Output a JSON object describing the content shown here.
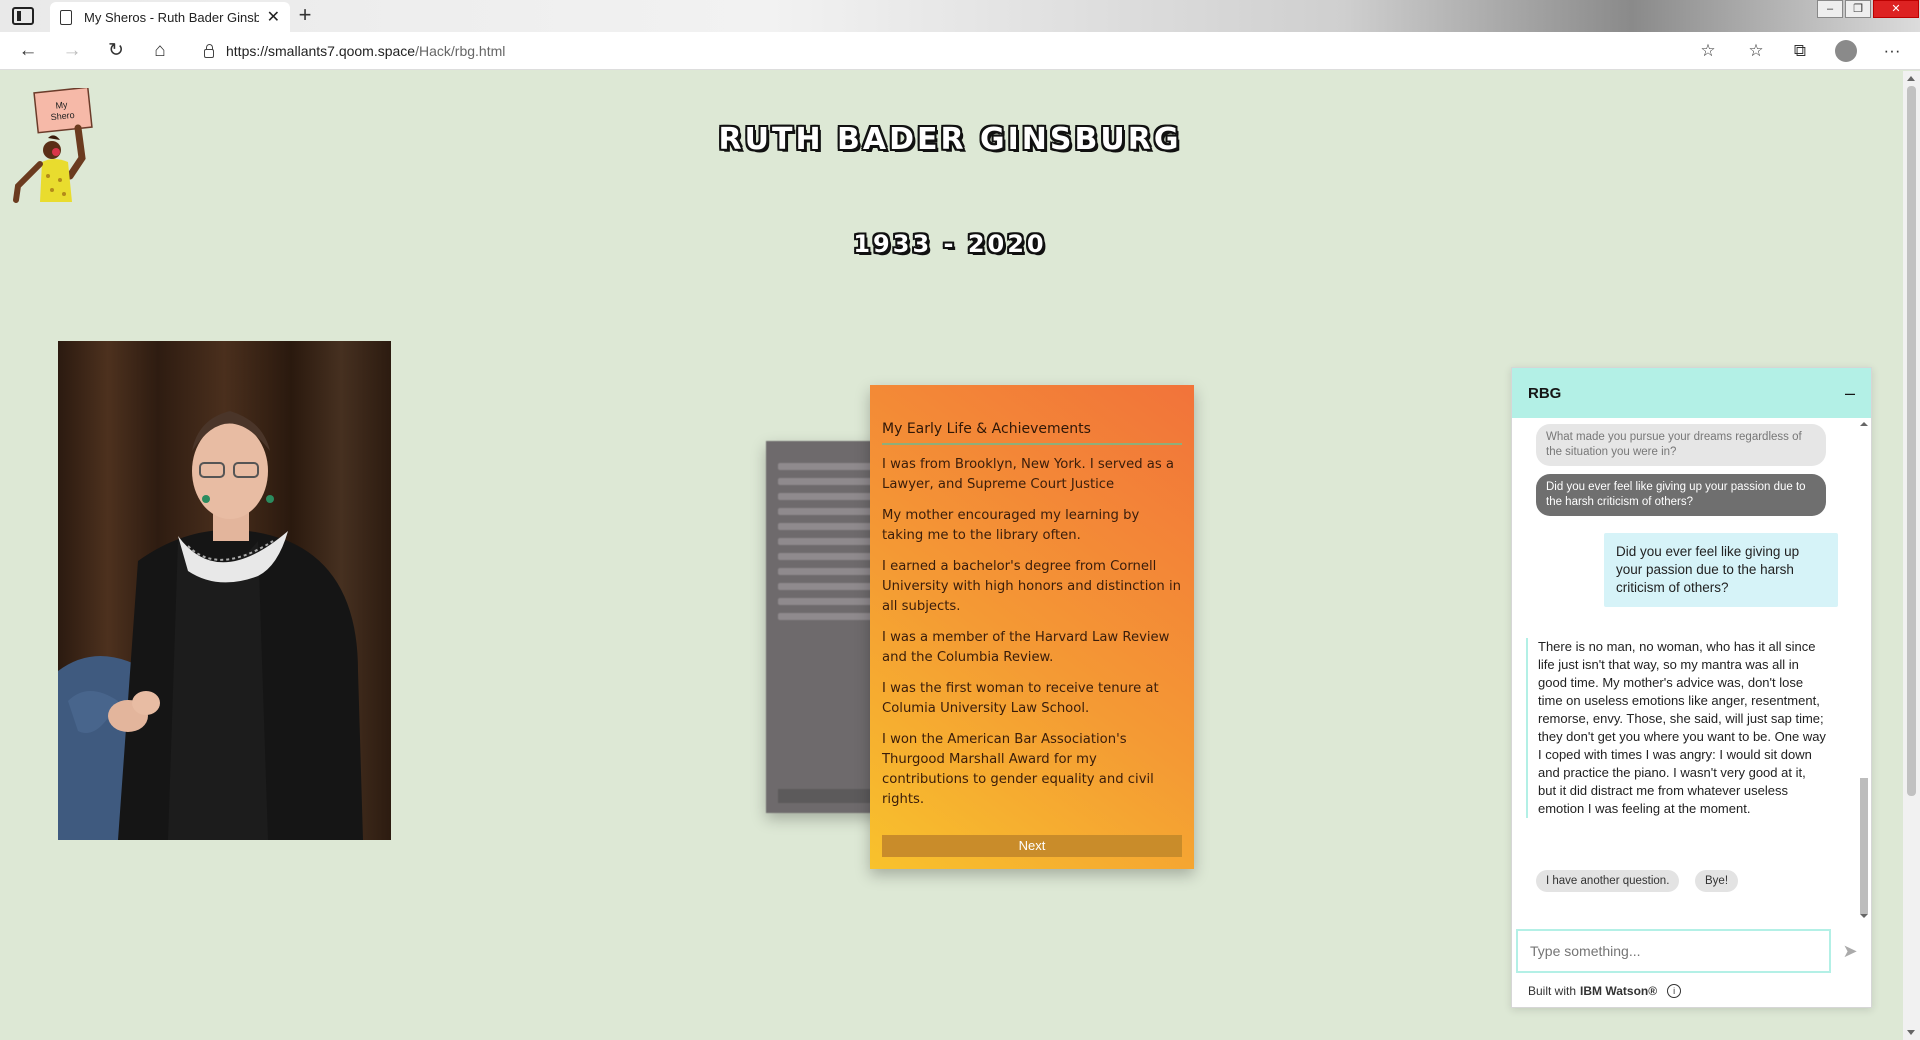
{
  "browser": {
    "tab_title": "My Sheros - Ruth Bader Ginsburg",
    "tab_close": "✕",
    "new_tab": "+",
    "url_host": "https://smallants7.qoom.space",
    "url_path": "/Hack/rbg.html",
    "nav": {
      "back": "←",
      "forward": "→",
      "reload": "↻",
      "home": "⌂"
    },
    "tools": {
      "favorite": "☆",
      "favorites": "☆",
      "collections": "⧉",
      "more": "···"
    },
    "window": {
      "minimize": "–",
      "restore": "❐",
      "close": "✕"
    }
  },
  "logo": {
    "sign_text_line1": "My",
    "sign_text_line2": "Shero"
  },
  "header": {
    "name": "RUTH BADER GINSBURG",
    "years": "1933 - 2020"
  },
  "card": {
    "title": "My Early Life & Achievements",
    "paragraphs": [
      "I was from Brooklyn, New York. I served as a Lawyer, and Supreme Court Justice",
      "My mother encouraged my learning by taking me to the library often.",
      "I earned a bachelor's degree from Cornell University with high honors and distinction in all subjects.",
      "I was a member of the Harvard Law Review and the Columbia Review.",
      "I was the first woman to receive tenure at Columia University Law School.",
      "I won the American Bar Association's Thurgood Marshall Award for my contributions to gender equality and civil rights."
    ],
    "next_label": "Next"
  },
  "chat": {
    "title": "RBG",
    "minimize": "–",
    "options": [
      "What made you pursue your dreams regardless of the situation you were in?",
      "Did you ever feel like giving up your passion due to the harsh criticism of others?"
    ],
    "user_message": "Did you ever feel like giving up your passion due to the harsh criticism of others?",
    "bot_message": "There is no man, no woman, who has it all since life just isn't that way, so my mantra was all in good time. My mother's advice was, don't lose time on useless emotions like anger, resentment, remorse, envy. Those, she said, will just sap time; they don't get you where you want to be. One way I coped with times I was angry: I would sit down and practice the piano. I wasn't very good at it, but it did distract me from whatever useless emotion I was feeling at the moment.",
    "quick_replies": [
      "I have another question.",
      "Bye!"
    ],
    "input_placeholder": "Type something...",
    "send_icon": "➤",
    "footer_prefix": "Built with",
    "footer_brand": "IBM Watson®",
    "info_icon": "i"
  },
  "colors": {
    "page_bg": "#dde8d5",
    "chat_accent": "#b3f0e6",
    "card_gradient_start": "#f8c22c",
    "card_gradient_end": "#f2733a"
  }
}
